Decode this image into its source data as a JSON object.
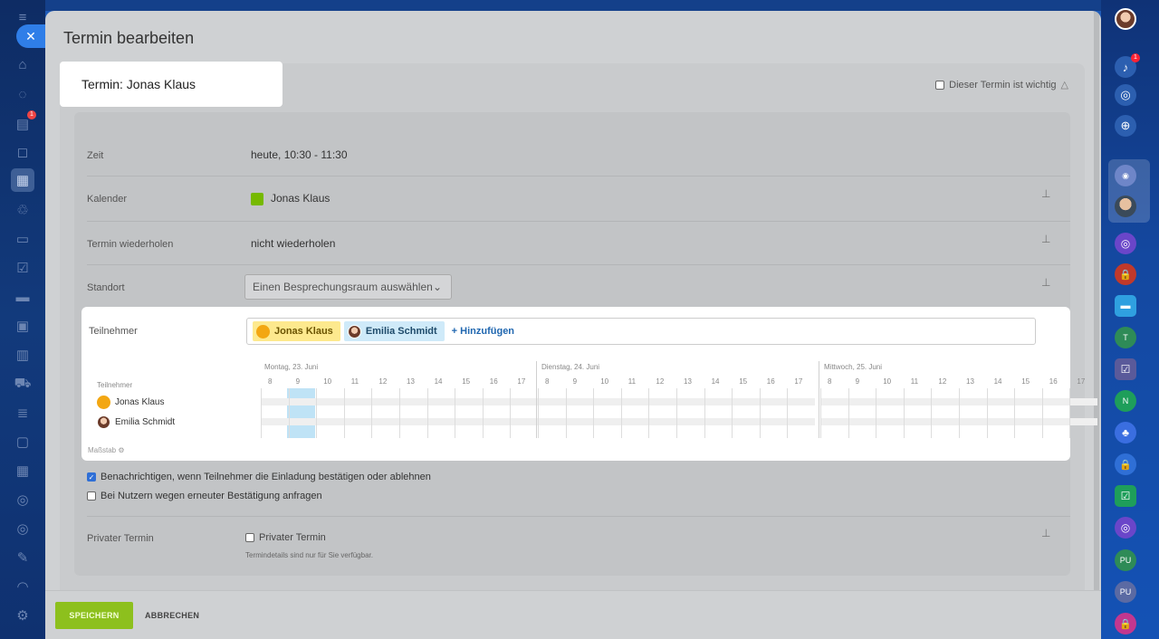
{
  "modal": {
    "title": "Termin bearbeiten",
    "event_title": "Termin: Jonas Klaus",
    "important_label": "Dieser Termin ist wichtig"
  },
  "fields": {
    "time": {
      "label": "Zeit",
      "value": "heute, 10:30 - 11:30"
    },
    "calendar": {
      "label": "Kalender",
      "value": "Jonas Klaus",
      "color": "#76b900"
    },
    "repeat": {
      "label": "Termin wiederholen",
      "value": "nicht wiederholen"
    },
    "location": {
      "label": "Standort",
      "selected": "Einen Besprechungsraum auswählen"
    },
    "participants": {
      "label": "Teilnehmer",
      "tags": [
        "Jonas Klaus",
        "Emilia Schmidt"
      ],
      "add_label": "+ Hinzufügen"
    }
  },
  "planner": {
    "header": "Teilnehmer",
    "users": [
      "Jonas Klaus",
      "Emilia Schmidt"
    ],
    "days": [
      "Montag, 23. Juni",
      "Dienstag, 24. Juni",
      "Mittwoch, 25. Juni"
    ],
    "hours": [
      "8",
      "9",
      "10",
      "11",
      "12",
      "13",
      "14",
      "15",
      "16",
      "17"
    ],
    "scale_label": "Maßstab"
  },
  "options": {
    "notify_label": "Benachrichtigen, wenn Teilnehmer die Einladung bestätigen oder ablehnen",
    "notify_checked": true,
    "reconfirm_label": "Bei Nutzern wegen erneuter Bestätigung anfragen",
    "reconfirm_checked": false
  },
  "private": {
    "label": "Privater Termin",
    "checkbox_label": "Privater Termin",
    "hint": "Termindetails sind nur für Sie verfügbar."
  },
  "footer": {
    "save": "SPEICHERN",
    "cancel": "ABBRECHEN"
  },
  "badges": {
    "left_top": "1",
    "left_tasks": "1",
    "right_bell": "1"
  },
  "right_avatars": [
    "T",
    "N",
    "PU",
    "PU"
  ]
}
